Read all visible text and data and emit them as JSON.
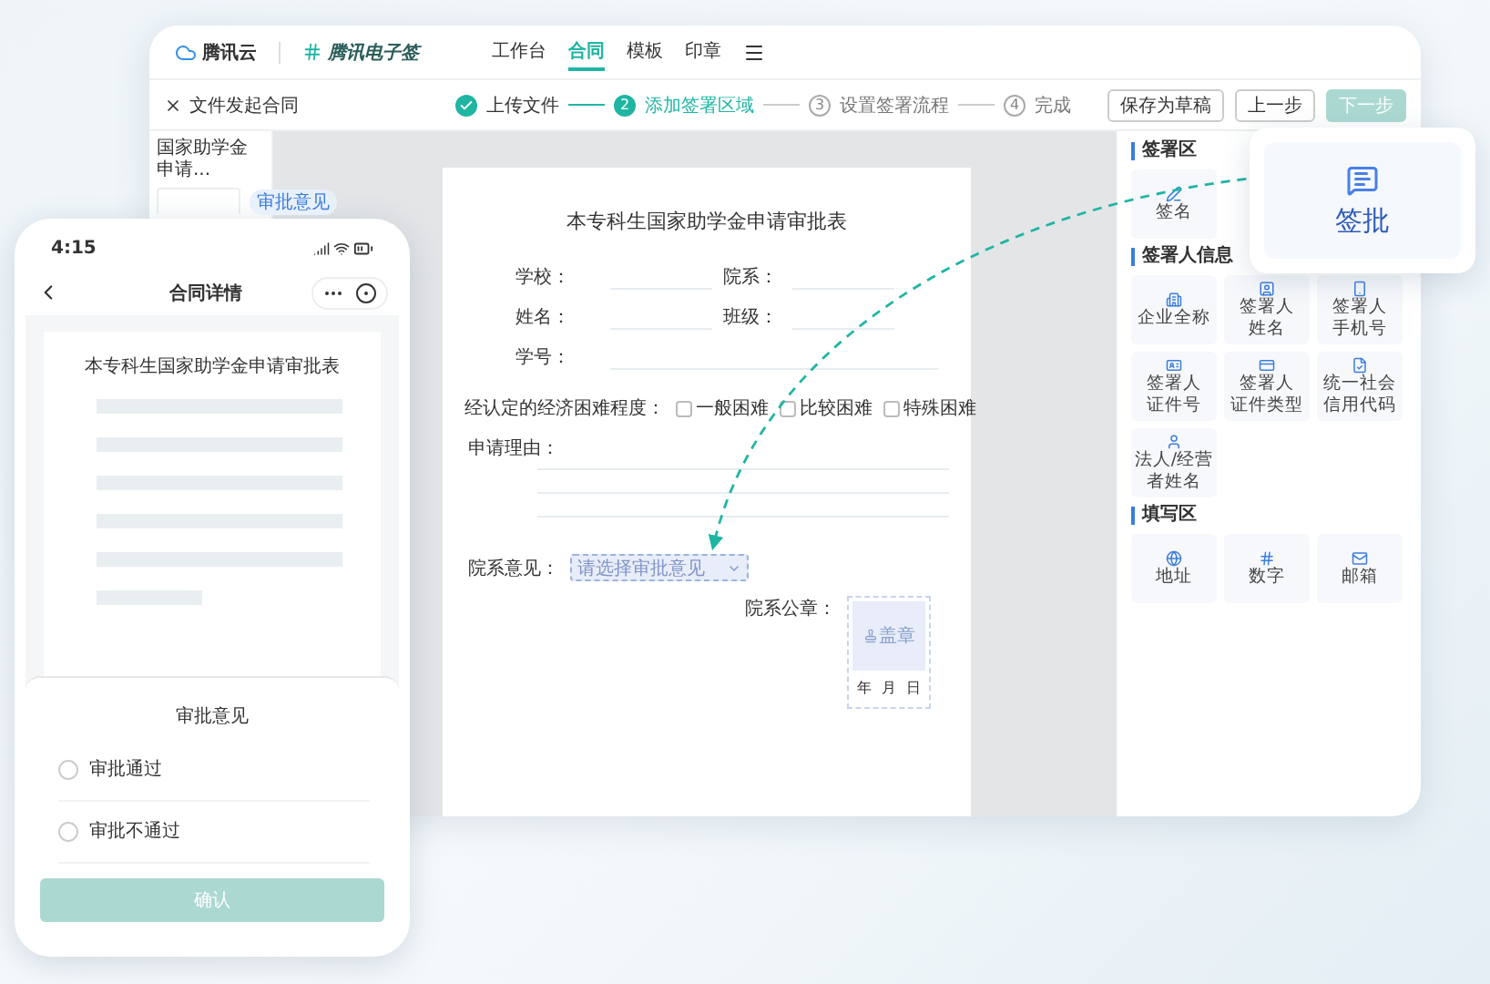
{
  "header": {
    "brand": "腾讯云",
    "product": "腾讯电子签",
    "nav": [
      {
        "label": "工作台",
        "selected": false
      },
      {
        "label": "合同",
        "selected": true
      },
      {
        "label": "模板",
        "selected": false
      },
      {
        "label": "印章",
        "selected": false
      }
    ]
  },
  "toolbar": {
    "title": "文件发起合同",
    "steps": [
      {
        "label": "上传文件",
        "kind": "done"
      },
      {
        "number": "2",
        "label": "添加签署区域",
        "kind": "active"
      },
      {
        "number": "3",
        "label": "设置签署流程",
        "kind": "todo"
      },
      {
        "number": "4",
        "label": "完成",
        "kind": "todo"
      }
    ],
    "buttons": [
      {
        "label": "保存为草稿",
        "kind": "default",
        "disabled": false
      },
      {
        "label": "上一步",
        "kind": "default",
        "disabled": false
      },
      {
        "label": "下一步",
        "kind": "primary",
        "disabled": true
      }
    ]
  },
  "sidebar": {
    "file_name": "国家助学金申请...",
    "tag": "审批意见"
  },
  "document": {
    "title": "本专科生国家助学金申请审批表",
    "field_rows": [
      [
        "学校：",
        "院系："
      ],
      [
        "姓名：",
        "班级："
      ],
      [
        "学号："
      ]
    ],
    "difficulty": {
      "label": "经认定的经济困难程度：",
      "options": [
        {
          "label": "一般困难",
          "checked": false
        },
        {
          "label": "比较困难",
          "checked": false
        },
        {
          "label": "特殊困难",
          "checked": false
        }
      ]
    },
    "reason": {
      "label": "申请理由："
    },
    "opinion": {
      "label": "院系意见：",
      "placeholder": "请选择审批意见"
    },
    "seal": {
      "label": "院系公章：",
      "placeholder": "盖章",
      "date": [
        "年",
        "月",
        "日"
      ]
    }
  },
  "panel": {
    "sections": [
      {
        "title": "签署区",
        "tiles": [
          {
            "lines": [
              "签名"
            ]
          }
        ]
      },
      {
        "title": "签署人信息",
        "tiles": [
          {
            "lines": [
              "企业全称"
            ]
          },
          {
            "lines": [
              "签署人",
              "姓名"
            ]
          },
          {
            "lines": [
              "签署人",
              "手机号"
            ]
          },
          {
            "lines": [
              "签署人",
              "证件号"
            ]
          },
          {
            "lines": [
              "签署人",
              "证件类型"
            ]
          },
          {
            "lines": [
              "统一社会",
              "信用代码"
            ]
          },
          {
            "lines": [
              "法人/经营",
              "者姓名"
            ]
          }
        ]
      },
      {
        "title": "填写区",
        "tiles": [
          {
            "lines": [
              "地址"
            ]
          },
          {
            "lines": [
              "数字"
            ]
          },
          {
            "lines": [
              "邮箱"
            ]
          }
        ]
      }
    ]
  },
  "popup": {
    "label": "签批"
  },
  "phone": {
    "time": "4:15",
    "title": "合同详情",
    "doc_title": "本专科生国家助学金申请审批表",
    "sheet": {
      "title": "审批意见",
      "options": [
        {
          "label": "审批通过",
          "selected": false
        },
        {
          "label": "审批不通过",
          "selected": false
        }
      ],
      "confirm": {
        "label": "确认",
        "disabled": true
      }
    }
  }
}
